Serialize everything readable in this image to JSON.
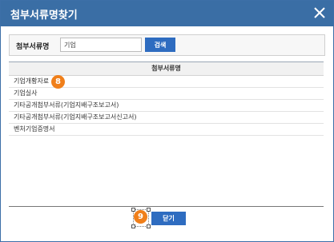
{
  "dialog": {
    "title": "첨부서류명찾기",
    "close_icon": "close-icon"
  },
  "search": {
    "label": "첨부서류명",
    "value": "기업",
    "button_label": "검색"
  },
  "table": {
    "header": "첨부서류명",
    "rows": [
      "기업개황자료",
      "기업실사",
      "기타공개첨부서류(기업지배구조보고서)",
      "기타공개첨부서류(기업지배구조보고서신고서)",
      "벤처기업증명서"
    ]
  },
  "footer": {
    "close_label": "닫기"
  },
  "annotations": {
    "badge_row": "8",
    "badge_close": "9"
  },
  "colors": {
    "titlebar": "#3a6ea5",
    "button": "#2e6cc0",
    "badge": "#f07f1a"
  }
}
